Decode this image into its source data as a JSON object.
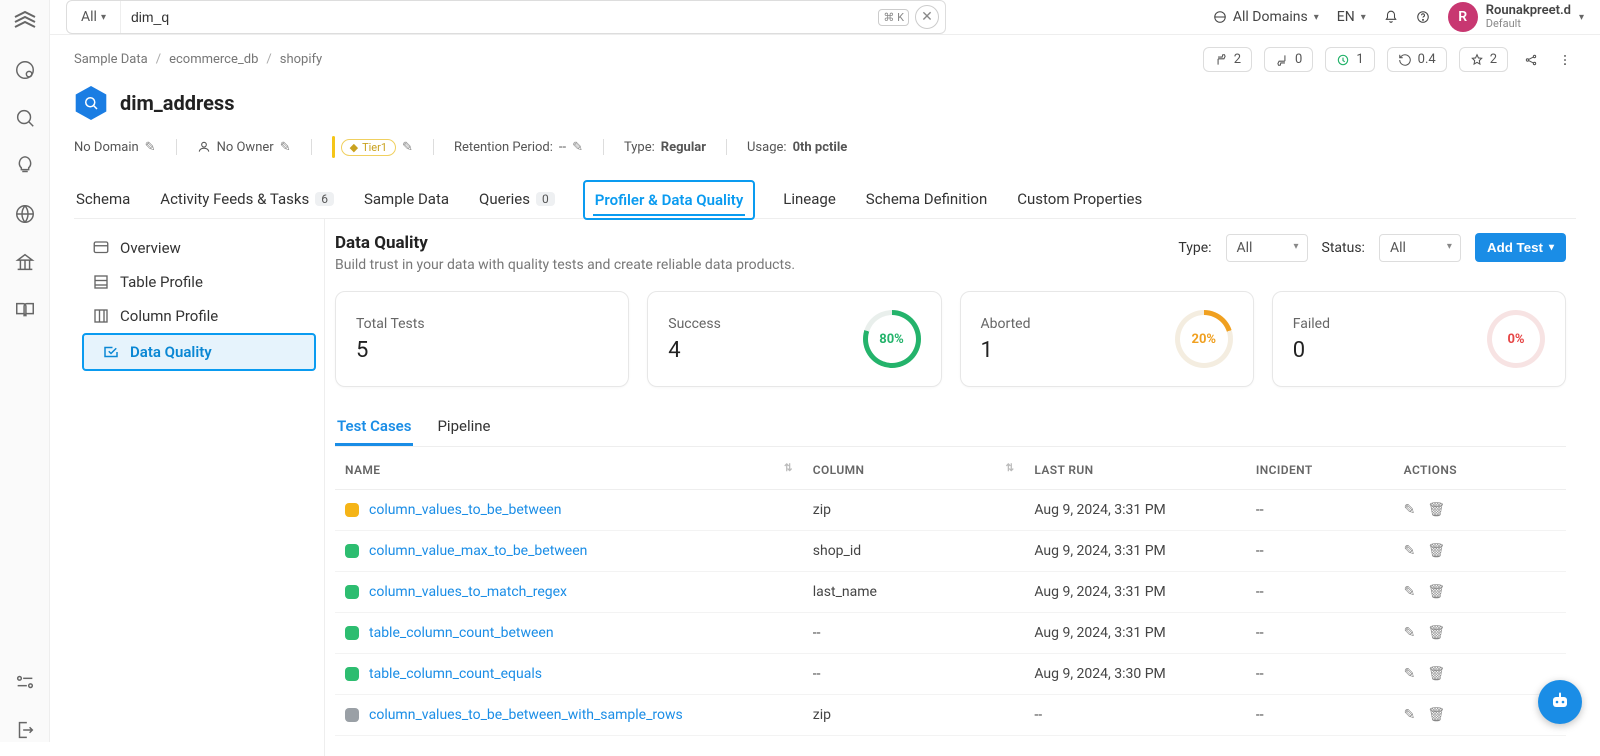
{
  "search": {
    "scope": "All",
    "value": "dim_q",
    "shortcut": "⌘ K"
  },
  "top": {
    "domains": "All Domains",
    "lang": "EN",
    "user_initial": "R",
    "user_name": "Rounakpreet.d",
    "user_role": "Default"
  },
  "breadcrumbs": [
    "Sample Data",
    "ecommerce_db",
    "shopify"
  ],
  "stats": {
    "thumbs_up": "2",
    "thumbs_down": "0",
    "pending": "1",
    "history": "0.4",
    "star": "2"
  },
  "entity": {
    "name": "dim_address"
  },
  "meta": {
    "domain": "No Domain",
    "owner": "No Owner",
    "tier": "Tier1",
    "retention_label": "Retention Period:",
    "retention_value": "--",
    "type_label": "Type:",
    "type_value": "Regular",
    "usage_label": "Usage:",
    "usage_value": "0th pctile"
  },
  "tabs": [
    {
      "label": "Schema"
    },
    {
      "label": "Activity Feeds & Tasks",
      "badge": "6"
    },
    {
      "label": "Sample Data"
    },
    {
      "label": "Queries",
      "badge": "0"
    },
    {
      "label": "Profiler & Data Quality",
      "active": true
    },
    {
      "label": "Lineage"
    },
    {
      "label": "Schema Definition"
    },
    {
      "label": "Custom Properties"
    }
  ],
  "side": [
    {
      "label": "Overview"
    },
    {
      "label": "Table Profile"
    },
    {
      "label": "Column Profile"
    },
    {
      "label": "Data Quality",
      "active": true
    }
  ],
  "dq": {
    "title": "Data Quality",
    "subtitle": "Build trust in your data with quality tests and create reliable data products.",
    "type_label": "Type:",
    "type_value": "All",
    "status_label": "Status:",
    "status_value": "All",
    "add_btn": "Add Test"
  },
  "cards": {
    "total_label": "Total Tests",
    "total_val": "5",
    "success_label": "Success",
    "success_val": "4",
    "success_pct": "80%",
    "aborted_label": "Aborted",
    "aborted_val": "1",
    "aborted_pct": "20%",
    "failed_label": "Failed",
    "failed_val": "0",
    "failed_pct": "0%"
  },
  "subtabs": {
    "testcases": "Test Cases",
    "pipeline": "Pipeline"
  },
  "table": {
    "headers": {
      "name": "NAME",
      "column": "COLUMN",
      "last_run": "LAST RUN",
      "incident": "INCIDENT",
      "actions": "ACTIONS"
    },
    "rows": [
      {
        "status": "yellow",
        "name": "column_values_to_be_between",
        "column": "zip",
        "last_run": "Aug 9, 2024, 3:31 PM",
        "incident": "--"
      },
      {
        "status": "green",
        "name": "column_value_max_to_be_between",
        "column": "shop_id",
        "last_run": "Aug 9, 2024, 3:31 PM",
        "incident": "--"
      },
      {
        "status": "green",
        "name": "column_values_to_match_regex",
        "column": "last_name",
        "last_run": "Aug 9, 2024, 3:31 PM",
        "incident": "--"
      },
      {
        "status": "green",
        "name": "table_column_count_between",
        "column": "--",
        "last_run": "Aug 9, 2024, 3:31 PM",
        "incident": "--"
      },
      {
        "status": "green",
        "name": "table_column_count_equals",
        "column": "--",
        "last_run": "Aug 9, 2024, 3:30 PM",
        "incident": "--"
      },
      {
        "status": "gray",
        "name": "column_values_to_be_between_with_sample_rows",
        "column": "zip",
        "last_run": "--",
        "incident": "--"
      }
    ]
  }
}
